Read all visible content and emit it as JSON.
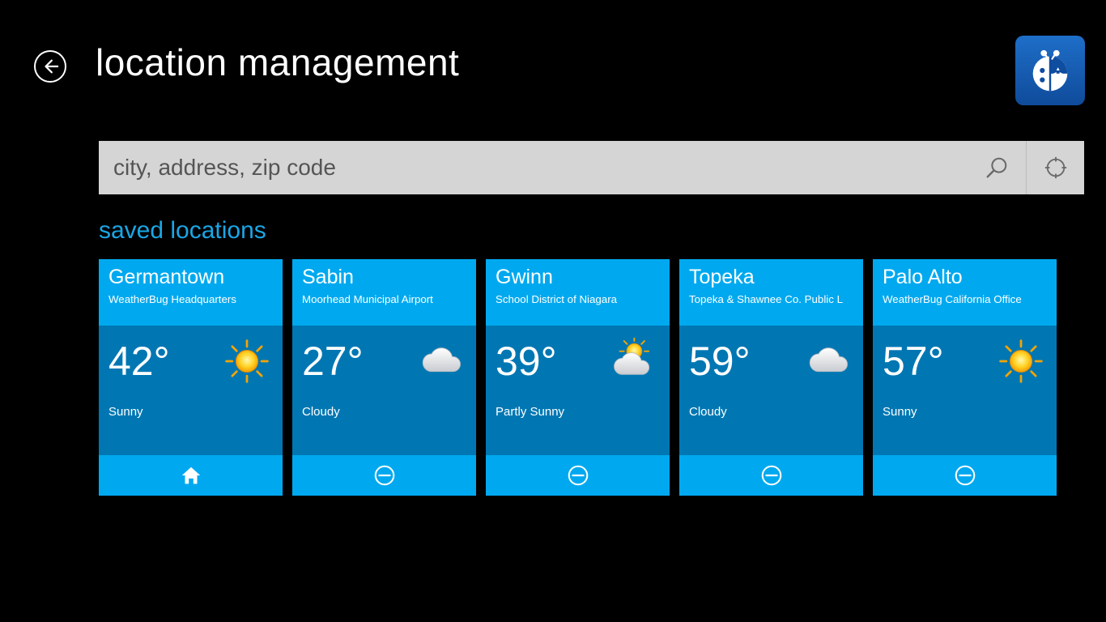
{
  "header": {
    "title": "location management"
  },
  "search": {
    "placeholder": "city, address, zip code"
  },
  "section_heading": "saved locations",
  "locations": [
    {
      "city": "Germantown",
      "subtitle": "WeatherBug Headquarters",
      "temp": "42°",
      "cond": "Sunny",
      "icon": "sun",
      "action": "home"
    },
    {
      "city": "Sabin",
      "subtitle": "Moorhead Municipal Airport",
      "temp": "27°",
      "cond": "Cloudy",
      "icon": "cloud",
      "action": "remove"
    },
    {
      "city": "Gwinn",
      "subtitle": "School District of Niagara",
      "temp": "39°",
      "cond": "Partly Sunny",
      "icon": "partly-sunny",
      "action": "remove"
    },
    {
      "city": "Topeka",
      "subtitle": "Topeka & Shawnee Co. Public L",
      "temp": "59°",
      "cond": "Cloudy",
      "icon": "cloud",
      "action": "remove"
    },
    {
      "city": "Palo Alto",
      "subtitle": "WeatherBug California Office",
      "temp": "57°",
      "cond": "Sunny",
      "icon": "sun",
      "action": "remove"
    }
  ]
}
